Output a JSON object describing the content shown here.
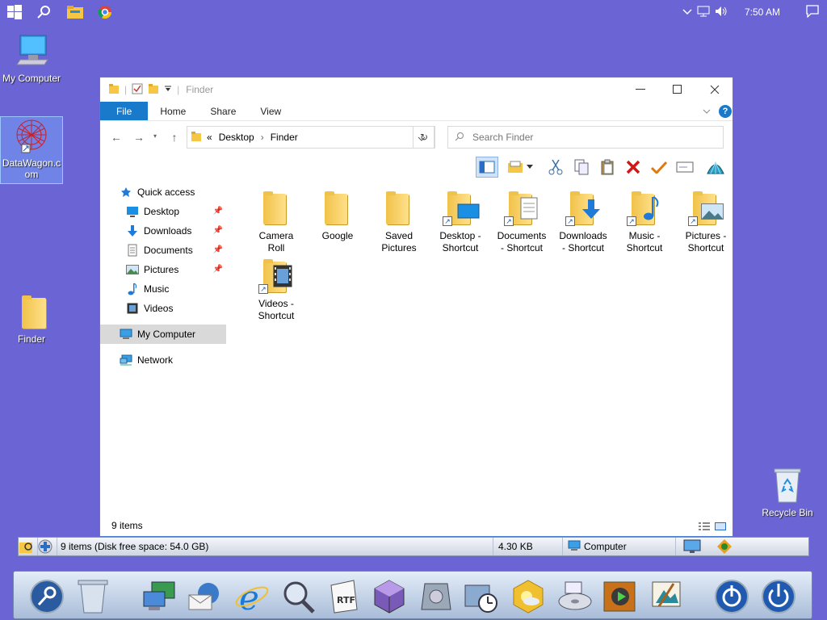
{
  "taskbar": {
    "clock": "7:50 AM",
    "icons": [
      "windows-start-icon",
      "search-icon",
      "file-explorer-icon",
      "chrome-icon"
    ],
    "tray_icons": [
      "chevron-up-icon",
      "network-icon",
      "volume-icon",
      "notification-icon"
    ]
  },
  "desktop": {
    "icons": [
      {
        "label": "My Computer",
        "icon": "computer-icon"
      },
      {
        "label": "DataWagon.c\nom",
        "icon": "datawagon-shortcut-icon"
      },
      {
        "label": "Finder",
        "icon": "folder-icon"
      },
      {
        "label": "Recycle Bin",
        "icon": "recycle-bin-icon"
      }
    ]
  },
  "window": {
    "title": "Finder",
    "ribbon_tabs": [
      "File",
      "Home",
      "Share",
      "View"
    ],
    "address": {
      "prefix": "«",
      "crumbs": [
        "Desktop",
        "Finder"
      ]
    },
    "search_placeholder": "Search Finder",
    "nav": {
      "quick_access": "Quick access",
      "items": [
        {
          "label": "Desktop",
          "pinned": true
        },
        {
          "label": "Downloads",
          "pinned": true
        },
        {
          "label": "Documents",
          "pinned": true
        },
        {
          "label": "Pictures",
          "pinned": true
        },
        {
          "label": "Music",
          "pinned": false
        },
        {
          "label": "Videos",
          "pinned": false
        }
      ],
      "my_computer": "My Computer",
      "network": "Network"
    },
    "files": [
      {
        "name": "Camera\nRoll",
        "shortcut": false
      },
      {
        "name": "Google",
        "shortcut": false
      },
      {
        "name": "Saved\nPictures",
        "shortcut": false
      },
      {
        "name": "Desktop -\nShortcut",
        "shortcut": true
      },
      {
        "name": "Documents\n- Shortcut",
        "shortcut": true
      },
      {
        "name": "Downloads\n- Shortcut",
        "shortcut": true
      },
      {
        "name": "Music -\nShortcut",
        "shortcut": true
      },
      {
        "name": "Pictures -\nShortcut",
        "shortcut": true
      },
      {
        "name": "Videos -\nShortcut",
        "shortcut": true
      }
    ],
    "status": "9 items"
  },
  "statusstrip": {
    "items": "9 items (Disk free space: 54.0 GB)",
    "size": "4.30 KB",
    "location": "Computer"
  },
  "colors": {
    "desktop": "#6a64d4",
    "accent": "#1979ca"
  }
}
